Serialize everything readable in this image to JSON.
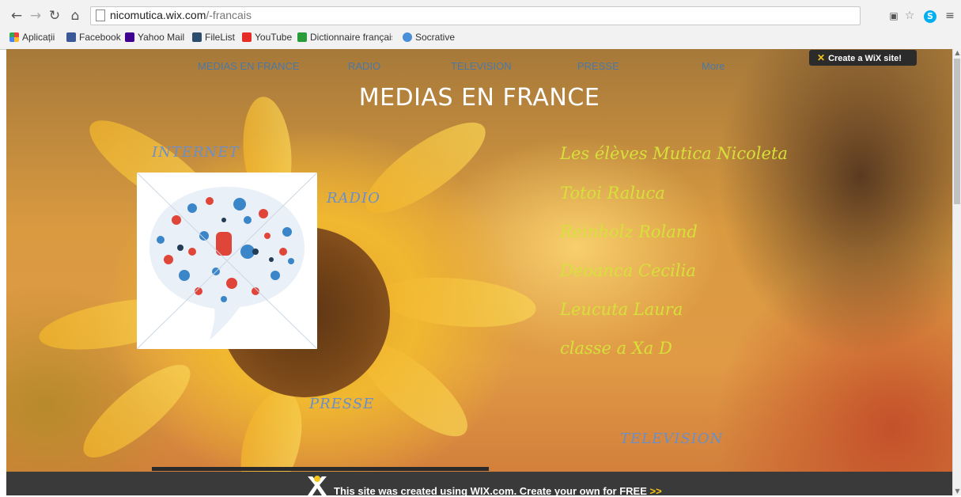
{
  "browser": {
    "url_host": "nicomutica.wix.com",
    "url_path": "/-francais",
    "bookmarks": [
      {
        "label": "Aplicații",
        "icon": "apps-grid-icon",
        "color": "#e8453c"
      },
      {
        "label": "Facebook",
        "icon": "facebook-icon",
        "color": "#3b5998"
      },
      {
        "label": "Yahoo Mail",
        "icon": "mail-icon",
        "color": "#400090"
      },
      {
        "label": "FileList",
        "icon": "filelist-icon",
        "color": "#2d4d6e"
      },
      {
        "label": "YouTube",
        "icon": "youtube-icon",
        "color": "#e52d27"
      },
      {
        "label": "Dictionnaire français",
        "icon": "dictionary-icon",
        "color": "#2a9d3a"
      },
      {
        "label": "Socrative",
        "icon": "socrative-icon",
        "color": "#4a90d9"
      }
    ]
  },
  "menu": {
    "items": [
      "MEDIAS EN FRANCE",
      "RADIO",
      "TELEVISION",
      "PRESSE",
      "More"
    ]
  },
  "wix_top_label": "Create a WiX site!",
  "page_title": "MEDIAS EN FRANCE",
  "labels": {
    "internet": "INTERNET",
    "radio": "RADIO",
    "presse": "PRESSE",
    "television": "TELEVISION"
  },
  "students": [
    "Les élèves  Mutica Nicoleta",
    "Totoi Raluca",
    "Reinholz Roland",
    "Deoanca Cecilia",
    "Leucuta Laura",
    "classe a Xa D"
  ],
  "footer": {
    "text": "This site was created using WIX.com. Create your own for FREE",
    "arrows": ">>"
  },
  "colors": {
    "menu_link": "#4a78a8",
    "student_text": "#d7e03a",
    "label_blue": "#6b8fc8",
    "wix_yellow": "#f5c518"
  }
}
